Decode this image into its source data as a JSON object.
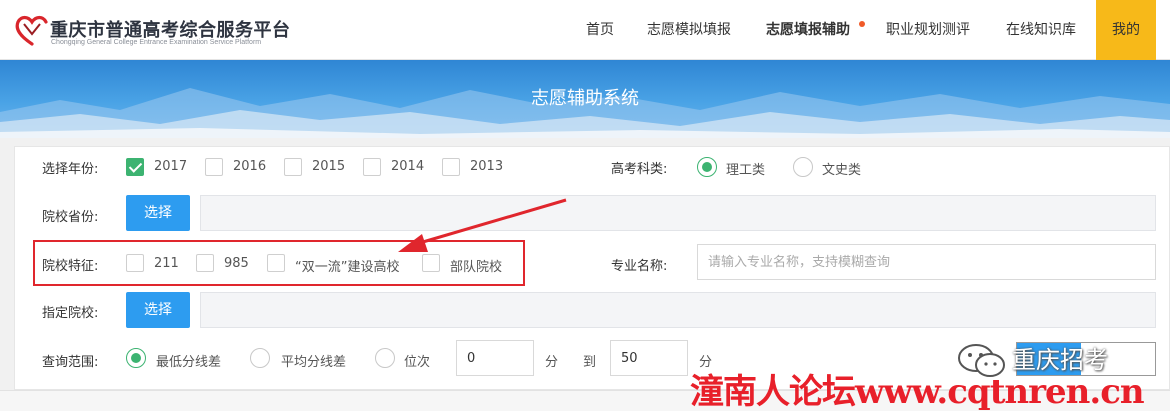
{
  "header": {
    "logo_title": "重庆市普通高考综合服务平台",
    "logo_subtitle": "Chongqing General College Entrance Examination Service Platform",
    "nav": [
      {
        "label": "首页"
      },
      {
        "label": "志愿模拟填报"
      },
      {
        "label": "志愿填报辅助",
        "active": true,
        "dot": true
      },
      {
        "label": "职业规划测评"
      },
      {
        "label": "在线知识库"
      }
    ],
    "mine_label": "我的"
  },
  "banner": {
    "title": "志愿辅助系统"
  },
  "form": {
    "year": {
      "label": "选择年份:",
      "options": [
        {
          "label": "2017",
          "checked": true
        },
        {
          "label": "2016",
          "checked": false
        },
        {
          "label": "2015",
          "checked": false
        },
        {
          "label": "2014",
          "checked": false
        },
        {
          "label": "2013",
          "checked": false
        }
      ]
    },
    "subject": {
      "label": "高考科类:",
      "options": [
        {
          "label": "理工类",
          "checked": true
        },
        {
          "label": "文史类",
          "checked": false
        }
      ]
    },
    "province": {
      "label": "院校省份:",
      "button": "选择"
    },
    "feature": {
      "label": "院校特征:",
      "options": [
        {
          "label": "211",
          "checked": false
        },
        {
          "label": "985",
          "checked": false
        },
        {
          "label": "“双一流”建设高校",
          "checked": false
        },
        {
          "label": "部队院校",
          "checked": false
        }
      ]
    },
    "major": {
      "label": "专业名称:",
      "placeholder": "请输入专业名称，支持模糊查询"
    },
    "college": {
      "label": "指定院校:",
      "button": "选择"
    },
    "range": {
      "label": "查询范围:",
      "options": [
        {
          "label": "最低分线差",
          "checked": true
        },
        {
          "label": "平均分线差",
          "checked": false
        },
        {
          "label": "位次",
          "checked": false
        }
      ],
      "from_value": "0",
      "unit1": "分",
      "to_label": "到",
      "to_value": "50",
      "unit2": "分"
    }
  },
  "overlay": {
    "watermark": "潼南人论坛www.cqtnren.cn",
    "wechat_name": "重庆招考"
  },
  "colors": {
    "accent_green": "#3cb371",
    "button_blue": "#2d9cf0",
    "mine_yellow": "#f7b919",
    "annotation_red": "#e0262d"
  }
}
